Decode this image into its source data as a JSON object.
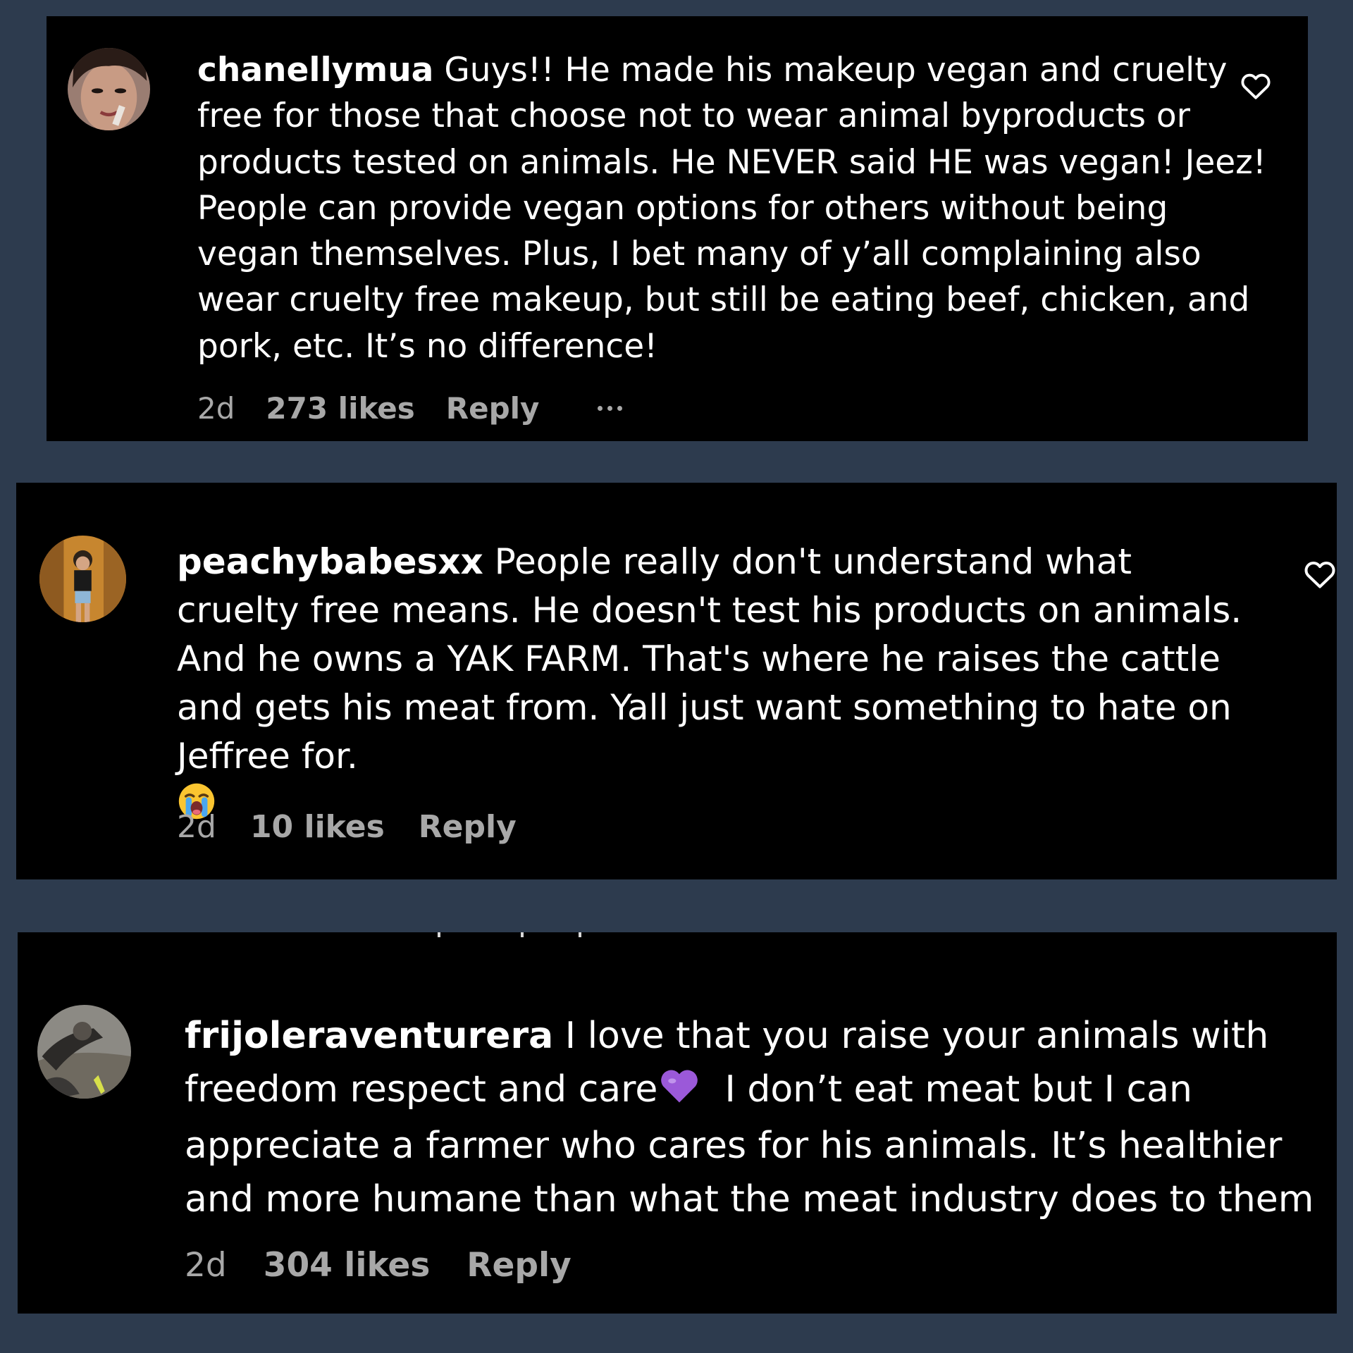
{
  "comments": [
    {
      "username": "chanellymua",
      "text": "Guys!! He made his makeup vegan and cruelty free for those that choose not to wear animal byproducts or products tested on animals. He NEVER said HE was vegan! Jeez! People can provide vegan options for others without being vegan themselves. Plus, I bet many of y’all complaining also wear cruelty free makeup, but still be eating beef, chicken, and pork, etc. It’s no difference!",
      "time": "2d",
      "likes": "273 likes",
      "reply": "Reply",
      "avatar_icon": "profile-photo",
      "has_more_menu": true,
      "has_heart": true
    },
    {
      "username": "peachybabesxx",
      "text": "People really don't understand what cruelty free means. He doesn't test his products on animals. And he owns a YAK FARM. That's where he raises the cattle and gets his meat from. Yall just want something to hate on Jeffree for.",
      "emoji": "😭",
      "emoji_name": "loudly-crying-face-emoji",
      "time": "2d",
      "likes": "10 likes",
      "reply": "Reply",
      "avatar_icon": "profile-photo",
      "has_heart": true
    },
    {
      "username": "frijoleraventurera",
      "text_before_emoji": "I love that you raise your animals with freedom respect and care",
      "emoji": "💜",
      "emoji_name": "purple-heart-emoji",
      "text_after_emoji": "I don’t eat meat but I can appreciate a farmer who cares for his animals. It’s healthier and more humane than what the meat industry does to them",
      "time": "2d",
      "likes": "304 likes",
      "reply": "Reply",
      "avatar_icon": "profile-photo",
      "has_heart": false
    }
  ],
  "colors": {
    "page_background": "#2d3b4e",
    "card_background": "#000000",
    "text_primary": "#ffffff",
    "text_secondary": "#a8a8a8"
  }
}
